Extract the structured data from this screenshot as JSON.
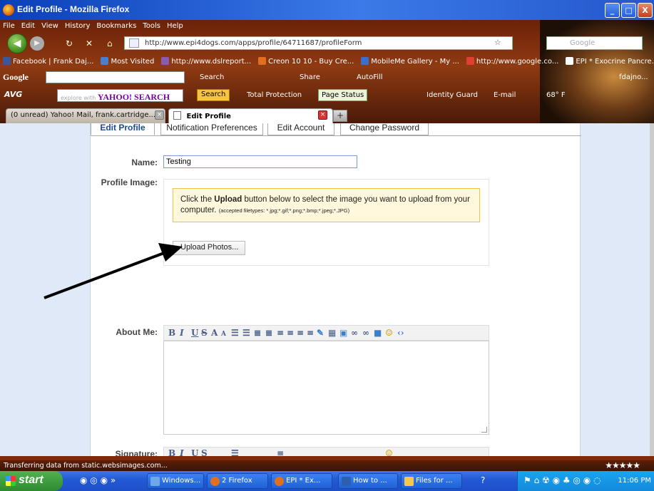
{
  "window": {
    "title": "Edit Profile - Mozilla Firefox",
    "buttons": {
      "minimize": "_",
      "maximize": "□",
      "close": "X"
    }
  },
  "menu": [
    "File",
    "Edit",
    "View",
    "History",
    "Bookmarks",
    "Tools",
    "Help"
  ],
  "nav": {
    "url": "http://www.epi4dogs.com/apps/profile/64711687/profileForm",
    "search_placeholder": "Google"
  },
  "bookmarks": [
    {
      "label": "Facebook | Frank Daj...",
      "color": "#3b5998"
    },
    {
      "label": "Most Visited",
      "color": "#4a7fd0"
    },
    {
      "label": "http://www.dslreport...",
      "color": "#8a5bb0"
    },
    {
      "label": "Creon 10 10 - Buy Cre...",
      "color": "#e07020"
    },
    {
      "label": "MobileMe Gallery - My ...",
      "color": "#3a6fd0"
    },
    {
      "label": "http://www.google.co...",
      "color": "#e04030"
    },
    {
      "label": "EPI * Exocrine Pancre...",
      "color": "#ffffff"
    }
  ],
  "google_toolbar": {
    "logo": "Google",
    "items": [
      "Search",
      "Share",
      "AutoFill"
    ],
    "user": "fdajno..."
  },
  "avg_toolbar": {
    "logo": "AVG",
    "search_hint": "explore with",
    "search_brand": "YAHOO! SEARCH",
    "search_button": "Search",
    "total_protection": "Total Protection",
    "page_status": "Page Status",
    "identity_guard": "Identity Guard",
    "email": "E-mail",
    "weather": "68° F"
  },
  "tabs": [
    {
      "label": "(0 unread) Yahoo! Mail, frank.cartridge..."
    },
    {
      "label": "Edit Profile"
    }
  ],
  "page": {
    "tabs": [
      "Edit Profile",
      "Notification Preferences",
      "Edit Account",
      "Change Password"
    ],
    "name_label": "Name:",
    "name_value": "Testing",
    "profile_image_label": "Profile Image:",
    "notice_prefix": "Click the ",
    "notice_bold": "Upload",
    "notice_rest": " button below to select the image you want to upload from your computer.",
    "notice_small": "(accepted filetypes: *.jpg;*.gif;*.png;*.bmp;*.jpeg;*.JPG)",
    "upload_button": "Upload Photos...",
    "about_label": "About Me:",
    "signature_label": "Signature:"
  },
  "status_text": "Transferring data from static.websimages.com...",
  "taskbar": {
    "start": "start",
    "items": [
      {
        "label": "Windows...",
        "color": "#6fa8e8"
      },
      {
        "label": "2 Firefox",
        "color": "#e07020"
      },
      {
        "label": "EPI * Ex...",
        "color": "#e07020"
      },
      {
        "label": "How to ...",
        "color": "#2d5fb0"
      },
      {
        "label": "Files for ...",
        "color": "#f2c94c"
      }
    ],
    "clock": "11:06 PM"
  },
  "colors": {
    "accent": "#1b4a9e",
    "notice_bg": "#fff8dc",
    "notice_border": "#f0c24a",
    "page_bg": "#dfe9f7"
  }
}
